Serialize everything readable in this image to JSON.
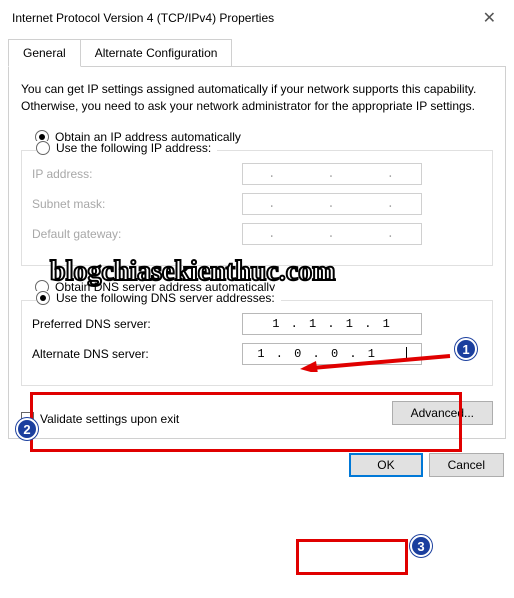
{
  "title": "Internet Protocol Version 4 (TCP/IPv4) Properties",
  "tabs": {
    "general": "General",
    "alt": "Alternate Configuration"
  },
  "hint": "You can get IP settings assigned automatically if your network supports this capability. Otherwise, you need to ask your network administrator for the appropriate IP settings.",
  "ip": {
    "auto": "Obtain an IP address automatically",
    "manual": "Use the following IP address:",
    "addr_label": "IP address:",
    "subnet_label": "Subnet mask:",
    "gateway_label": "Default gateway:"
  },
  "dns": {
    "auto": "Obtain DNS server address automatically",
    "manual": "Use the following DNS server addresses:",
    "preferred_label": "Preferred DNS server:",
    "alternate_label": "Alternate DNS server:",
    "preferred_value": "1 . 1 . 1 . 1",
    "alternate_value": "1 . 0 . 0 . 1"
  },
  "validate": "Validate settings upon exit",
  "advanced": "Advanced...",
  "ok": "OK",
  "cancel": "Cancel",
  "watermark": "blogchiasekienthuc.com",
  "annotations": {
    "b1": "1",
    "b2": "2",
    "b3": "3"
  }
}
